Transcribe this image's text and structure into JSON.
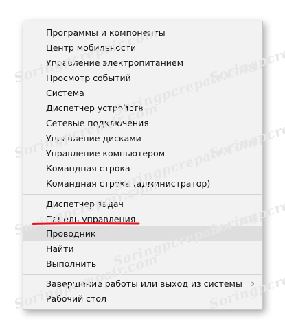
{
  "menu": {
    "items": [
      {
        "label": "Программы и компоненты"
      },
      {
        "label": "Центр мобильности"
      },
      {
        "label": "Управление электропитанием"
      },
      {
        "label": "Просмотр событий"
      },
      {
        "label": "Система"
      },
      {
        "label": "Диспетчер устройств"
      },
      {
        "label": "Сетевые подключения"
      },
      {
        "label": "Управление дисками"
      },
      {
        "label": "Управление компьютером"
      },
      {
        "label": "Командная строка"
      },
      {
        "label": "Командная строка (администратор)"
      },
      {
        "label": "Диспетчер задач"
      },
      {
        "label": "Панель управления"
      },
      {
        "label": "Проводник"
      },
      {
        "label": "Найти"
      },
      {
        "label": "Выполнить"
      },
      {
        "label": "Завершение работы или выход из системы"
      },
      {
        "label": "Рабочий стол"
      }
    ],
    "submenu_chevron": "›"
  },
  "watermark": {
    "text": "Soringpcrepair.com"
  },
  "colors": {
    "menu_background": "#f2f2f2",
    "highlight": "#dedede",
    "underline_red": "#e8121e"
  },
  "icons": {
    "submenu": "chevron-right-icon"
  }
}
